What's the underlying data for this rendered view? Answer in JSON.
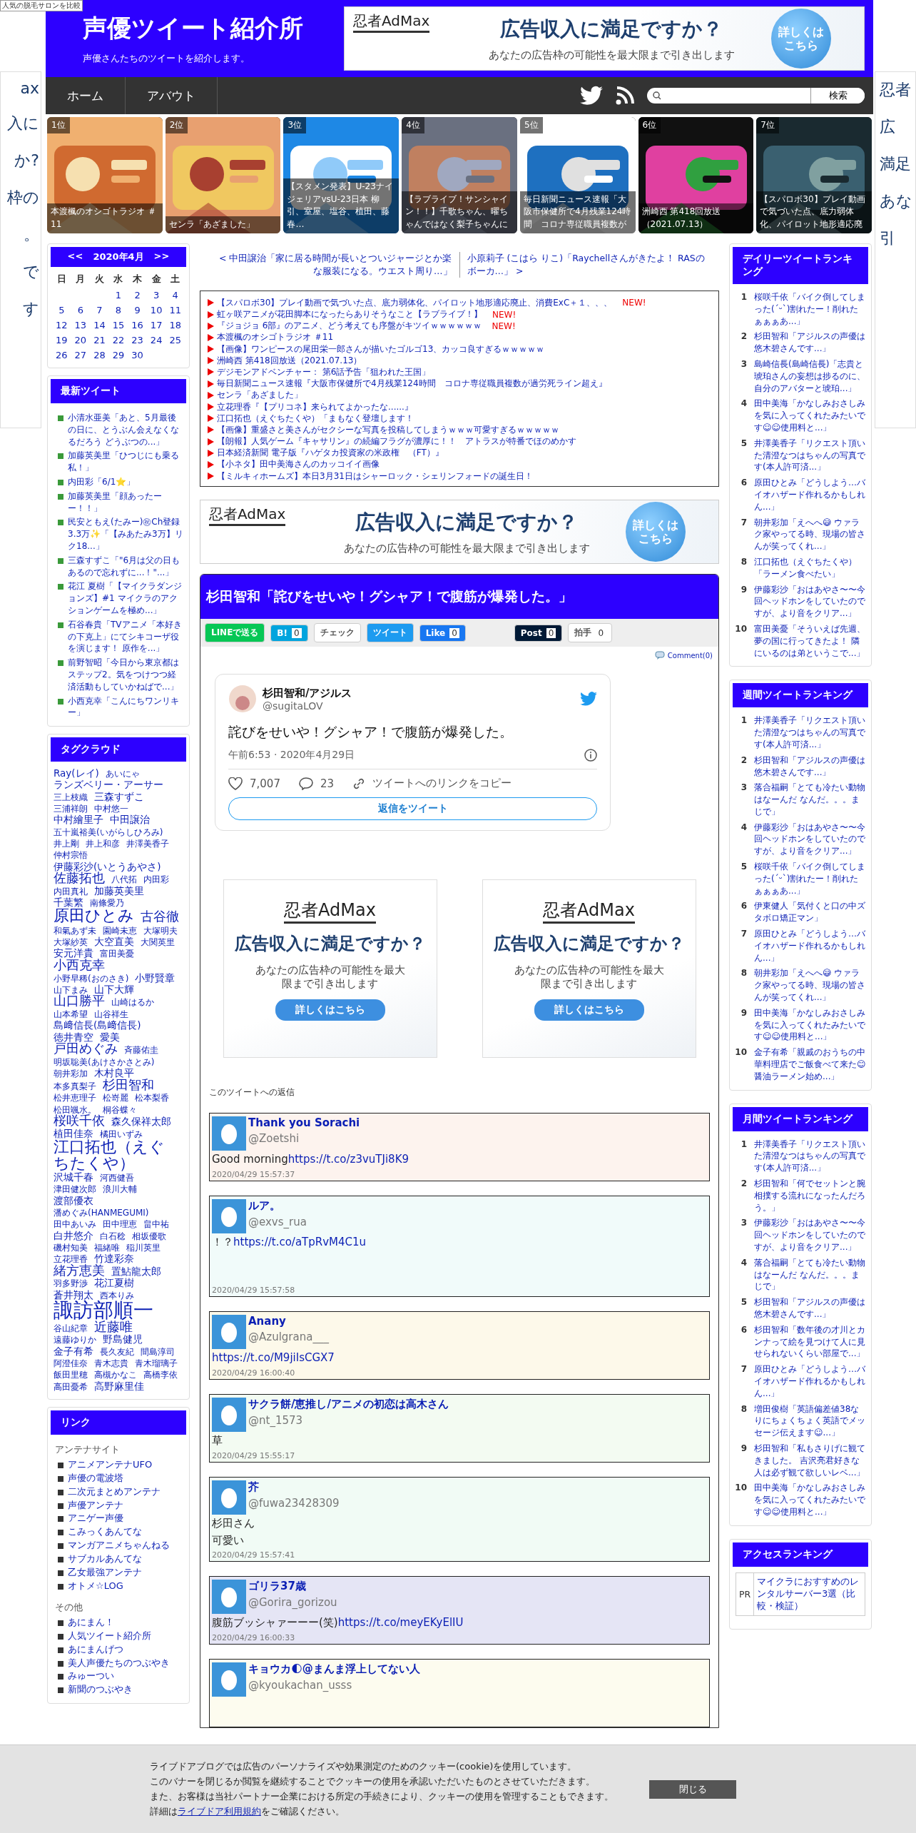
{
  "corner_label": "人気の脱毛サロンを比較",
  "side_ads": {
    "left": [
      "ax",
      "入に",
      "か?",
      "枠の",
      "。",
      "で",
      "す"
    ],
    "right": [
      "忍者",
      "広",
      "満足",
      "あな",
      "引"
    ]
  },
  "header": {
    "title": "声優ツイート紹介所",
    "subtitle": "声優さんたちのツイートを紹介します。",
    "ad": {
      "brand": "忍者AdMax",
      "headline": "広告収入に満足ですか？",
      "subline": "あなたの広告枠の可能性を最大限まで引き出します",
      "cta": "詳しくはこちら"
    }
  },
  "nav": {
    "items": [
      {
        "label": "ホーム"
      },
      {
        "label": "アバウト"
      }
    ],
    "search_button": "検索"
  },
  "featured": [
    {
      "rank": "1位",
      "caption": "本渡楓のオシゴトラジオ ＃11"
    },
    {
      "rank": "2位",
      "caption": "センラ「あざました」"
    },
    {
      "rank": "3位",
      "caption": "【スタメン発表】U-23ナイジェリアvsU-23日本 柳引、室屋、塩谷、植田、藤春…"
    },
    {
      "rank": "4位",
      "caption": "【ラブライブ！サンシャイン！！】千歌ちゃん、曜ちゃんではなく梨子ちゃんに"
    },
    {
      "rank": "5位",
      "caption": "毎日新聞ニュース速報「大阪市保健所で4月残業124時間　コロナ専従職員複数が"
    },
    {
      "rank": "6位",
      "caption": "洲崎西 第418回放送（2021.07.13）"
    },
    {
      "rank": "7位",
      "caption": "【スパロボ30】プレイ動画で気づいた点、底力弱体化、パイロット地形適応廃"
    }
  ],
  "calendar": {
    "prev": "<<",
    "month": "2020年4月",
    "next": ">>",
    "weekdays": [
      "日",
      "月",
      "火",
      "水",
      "木",
      "金",
      "土"
    ],
    "weeks": [
      [
        "1",
        "2",
        "3",
        "4"
      ],
      [
        "5",
        "6",
        "7",
        "8",
        "9",
        "10",
        "11"
      ],
      [
        "12",
        "13",
        "14",
        "15",
        "16",
        "17",
        "18"
      ],
      [
        "19",
        "20",
        "21",
        "22",
        "23",
        "24",
        "25"
      ],
      [
        "26",
        "27",
        "28",
        "29",
        "30"
      ]
    ]
  },
  "latest_tweets": {
    "title": "最新ツイート",
    "items": [
      "小清水亜美「あと、5月最後の日に、とうぶん会えなくなるだろう どうぶつの...」",
      "加藤英美里「ひつじにも乗る私！」",
      "内田彩「6/1⭐」",
      "加藤英美里「顔あったーー！！」",
      "民安ともえ(たみー)㊗Ch登録3.3万✨「【みあたみ3万】リク18...」",
      "三森すずこ「\"6月は父の日もあるので忘れずに...！\"...」",
      "花江 夏樹「【マイクラダンジョンズ】#1 マイクラのアクションゲームを極め...」",
      "石谷春貴「TVアニメ「本好きの下克上」にてシキコーザ役を演じます！ 原作を...」",
      "前野智昭「今日から東京都はステップ2。気をつけつつ経済活動もしていかねばで...」",
      "小西克幸「こんにちワンリキー」"
    ]
  },
  "tag_cloud": {
    "title": "タグクラウド",
    "tags": [
      {
        "label": "Ray(レイ)",
        "kind": "medium"
      },
      {
        "label": "あいにゃ",
        "kind": "small"
      },
      {
        "label": "ランズベリー・アーサー",
        "kind": "medium"
      },
      {
        "label": "三上枝織",
        "kind": "small"
      },
      {
        "label": "三森すずこ",
        "kind": "medium"
      },
      {
        "label": "三浦祥朗",
        "kind": "small"
      },
      {
        "label": "中村悠一",
        "kind": "small"
      },
      {
        "label": "中村繪里子",
        "kind": "medium"
      },
      {
        "label": "中田譲治",
        "kind": "medium"
      },
      {
        "label": "五十嵐裕美(いがらしひろみ)",
        "kind": "small"
      },
      {
        "label": "井上剛",
        "kind": "small"
      },
      {
        "label": "井上和彦",
        "kind": "small"
      },
      {
        "label": "井澤美香子",
        "kind": "small"
      },
      {
        "label": "仲村宗悟",
        "kind": "small"
      },
      {
        "label": "伊藤彩沙(いとうあやさ)",
        "kind": "medium"
      },
      {
        "label": "佐藤拓也",
        "kind": "large"
      },
      {
        "label": "八代拓",
        "kind": "small"
      },
      {
        "label": "内田彩",
        "kind": "small"
      },
      {
        "label": "内田真礼",
        "kind": "small"
      },
      {
        "label": "加藤英美里",
        "kind": "medium"
      },
      {
        "label": "千葉繁",
        "kind": "medium"
      },
      {
        "label": "南條愛乃",
        "kind": "small"
      },
      {
        "label": "原田ひとみ",
        "kind": "huge"
      },
      {
        "label": "古谷徹",
        "kind": "large"
      },
      {
        "label": "和氣あず未",
        "kind": "small"
      },
      {
        "label": "園崎未恵",
        "kind": "small"
      },
      {
        "label": "大塚明夫",
        "kind": "small"
      },
      {
        "label": "大塚紗英",
        "kind": "small"
      },
      {
        "label": "大空直美",
        "kind": "medium"
      },
      {
        "label": "大関英里",
        "kind": "small"
      },
      {
        "label": "安元洋貴",
        "kind": "medium"
      },
      {
        "label": "富田美憂",
        "kind": "small"
      },
      {
        "label": "小西克幸",
        "kind": "large"
      },
      {
        "label": "小野早稀(おのさき)",
        "kind": "small"
      },
      {
        "label": "小野賢章",
        "kind": "medium"
      },
      {
        "label": "山下まみ",
        "kind": "small"
      },
      {
        "label": "山下大輝",
        "kind": "medium"
      },
      {
        "label": "山口勝平",
        "kind": "large"
      },
      {
        "label": "山崎はるか",
        "kind": "small"
      },
      {
        "label": "山本希望",
        "kind": "small"
      },
      {
        "label": "山谷祥生",
        "kind": "small"
      },
      {
        "label": "島﨑信長(島﨑信長)",
        "kind": "medium"
      },
      {
        "label": "徳井青空",
        "kind": "medium"
      },
      {
        "label": "愛美",
        "kind": "medium"
      },
      {
        "label": "戸田めぐみ",
        "kind": "large"
      },
      {
        "label": "斉藤佑圭",
        "kind": "small"
      },
      {
        "label": "明坂聡美(あけさかさとみ)",
        "kind": "small"
      },
      {
        "label": "朝井彩加",
        "kind": "small"
      },
      {
        "label": "木村良平",
        "kind": "medium"
      },
      {
        "label": "本多真梨子",
        "kind": "small"
      },
      {
        "label": "杉田智和",
        "kind": "large"
      },
      {
        "label": "松井恵理子",
        "kind": "small"
      },
      {
        "label": "松嵜麗",
        "kind": "small"
      },
      {
        "label": "松本梨香",
        "kind": "small"
      },
      {
        "label": "松田颯水。",
        "kind": "small"
      },
      {
        "label": "桐谷蝶々",
        "kind": "small"
      },
      {
        "label": "桜咲千依",
        "kind": "large"
      },
      {
        "label": "森久保祥太郎",
        "kind": "medium"
      },
      {
        "label": "植田佳奈",
        "kind": "medium"
      },
      {
        "label": "橘田いずみ",
        "kind": "small"
      },
      {
        "label": "江口拓也（えぐちたくや）",
        "kind": "huge"
      },
      {
        "label": "沢城千春",
        "kind": "medium"
      },
      {
        "label": "河西健吾",
        "kind": "small"
      },
      {
        "label": "津田健次郎",
        "kind": "small"
      },
      {
        "label": "浪川大輔",
        "kind": "small"
      },
      {
        "label": "渡部優衣",
        "kind": "medium"
      },
      {
        "label": "潘めぐみ(HANMEGUMI)",
        "kind": "small"
      },
      {
        "label": "田中あいみ",
        "kind": "small"
      },
      {
        "label": "田中理恵",
        "kind": "small"
      },
      {
        "label": "畠中祐",
        "kind": "small"
      },
      {
        "label": "白井悠介",
        "kind": "medium"
      },
      {
        "label": "白石稔",
        "kind": "small"
      },
      {
        "label": "相坂優歌",
        "kind": "small"
      },
      {
        "label": "磯村知美",
        "kind": "small"
      },
      {
        "label": "福緒唯",
        "kind": "small"
      },
      {
        "label": "稲川英里",
        "kind": "small"
      },
      {
        "label": "立花理香",
        "kind": "small"
      },
      {
        "label": "竹達彩奈",
        "kind": "medium"
      },
      {
        "label": "緒方恵美",
        "kind": "large"
      },
      {
        "label": "置鮎龍太郎",
        "kind": "medium"
      },
      {
        "label": "羽多野渉",
        "kind": "small"
      },
      {
        "label": "花江夏樹",
        "kind": "medium"
      },
      {
        "label": "蒼井翔太",
        "kind": "medium"
      },
      {
        "label": "西本りみ",
        "kind": "small"
      },
      {
        "label": "諏訪部順一",
        "kind": "giant"
      },
      {
        "label": "谷山紀章",
        "kind": "small"
      },
      {
        "label": "近藤唯",
        "kind": "large"
      },
      {
        "label": "遠藤ゆりか",
        "kind": "small"
      },
      {
        "label": "野島健児",
        "kind": "medium"
      },
      {
        "label": "金子有希",
        "kind": "medium"
      },
      {
        "label": "長久友紀",
        "kind": "small"
      },
      {
        "label": "間島淳司",
        "kind": "small"
      },
      {
        "label": "阿澄佳奈",
        "kind": "small"
      },
      {
        "label": "青木志貴",
        "kind": "small"
      },
      {
        "label": "青木瑠璃子",
        "kind": "small"
      },
      {
        "label": "飯田里穂",
        "kind": "small"
      },
      {
        "label": "高槻かなこ",
        "kind": "small"
      },
      {
        "label": "高橋李依",
        "kind": "small"
      },
      {
        "label": "高田憂希",
        "kind": "small"
      },
      {
        "label": "高野麻里佳",
        "kind": "medium"
      }
    ]
  },
  "links": {
    "title": "リンク",
    "groups": [
      {
        "heading": "アンテナサイト",
        "items": [
          "アニメアンテナUFO",
          "声優の電波塔",
          "二次元まとめアンテナ",
          "声優アンテナ",
          "アニゲー声優",
          "こみっくあんてな",
          "マンガアニメちゃんねる",
          "サブカルあんてな",
          "乙女最強アンテナ",
          "オトメ☆LOG"
        ]
      },
      {
        "heading": "その他",
        "items": [
          "あにまん！",
          "人気ツイート紹介所",
          "あにまんげつ",
          "美人声優たちのつぶやき",
          "みゅーつい",
          "新聞のつぶやき"
        ]
      }
    ]
  },
  "article_nav": {
    "prev": "< 中田譲治「家に居る時間が長いとついジャージとか楽な服装になる。ウエスト周り…」",
    "next": "小原莉子 (こはら りこ)「Raychellさんがきたよ！ RASのボーカ…」 >"
  },
  "news": [
    {
      "text": "【スパロボ30】プレイ動画で気づいた点、底力弱体化、パイロット地形適応廃止、消費ExC＋１、、、",
      "badge": "NEW!"
    },
    {
      "text": "虹ヶ咲アニメが花田脚本になったらありそうなこと【ラブライブ！】",
      "badge": "NEW!"
    },
    {
      "text": "『ジョジョ 6部』のアニメ、どう考えても序盤がキツイｗｗｗｗｗｗ",
      "badge": "NEW!"
    },
    {
      "text": "本渡楓のオシゴトラジオ ＃11"
    },
    {
      "text": "【画像】ワンピースの尾田栄一郎さんが描いたゴルゴ13、カッコ良すぎるｗｗｗｗｗ"
    },
    {
      "text": "洲崎西 第418回放送（2021.07.13）"
    },
    {
      "text": "デジモンアドベンチャー： 第6話予告「狙われた王国」"
    },
    {
      "text": "毎日新聞ニュース速報『大阪市保健所で4月残業124時間　コロナ専従職員複数が過労死ライン超え』"
    },
    {
      "text": "センラ「あざました」"
    },
    {
      "text": "立花理香『【プリコネ】来られてよかったな......』"
    },
    {
      "text": "江口拓也（えぐちたくや）「まもなく登壇します！"
    },
    {
      "text": "【画像】重盛さと美さんがセクシーな写真を投稿してしまうｗｗｗ可愛すぎるｗｗｗｗｗ"
    },
    {
      "text": "【朗報】人気ゲーム『キャサリン』の続編フラグが濃厚に！！　アトラスが特番でほのめかす"
    },
    {
      "text": "日本経済新聞 電子版『ハゲタカ投資家の米政権　（FT）』"
    },
    {
      "text": "【小ネタ】田中美海さんのカッコイイ画像"
    },
    {
      "text": "【ミルキィホームズ】本日3月31日はシャーロック・シェリンフォードの誕生日！"
    }
  ],
  "article": {
    "title": "杉田智和「詫びをせいや！グシャア！で腹筋が爆発した。」",
    "share": [
      {
        "kind": "line",
        "label": "LINEで送る"
      },
      {
        "kind": "hatena",
        "label": "B!",
        "count": "0"
      },
      {
        "kind": "check",
        "label": "チェック"
      },
      {
        "kind": "tweet",
        "label": "ツイート"
      },
      {
        "kind": "like",
        "label": "Like",
        "count": "0"
      },
      {
        "kind": "post",
        "label": "Post",
        "count": "0"
      },
      {
        "kind": "clap",
        "label": "拍手",
        "count": "0"
      }
    ],
    "comments": "Comment(0)",
    "tweet": {
      "name": "杉田智和/アジルス",
      "handle": "@sugitaLOV",
      "text": "詫びをせいや！グシャア！で腹筋が爆発した。",
      "time": "午前6:53 · 2020年4月29日",
      "likes": "7,007",
      "replies": "23",
      "copy_link": "ツイートへのリンクをコピー",
      "reply_button": "返信をツイート"
    },
    "ad": {
      "brand": "忍者AdMax",
      "headline": "広告収入に満足ですか？",
      "subline": "あなたの広告枠の可能性を最大限まで引き出します",
      "cta": "詳しくはこちら"
    },
    "box_ads": [
      {
        "brand": "忍者AdMax",
        "headline": "広告収入に満足ですか？",
        "subline": "あなたの広告枠の可能性を最大限まで引き出します",
        "cta": "詳しくはこちら"
      },
      {
        "brand": "忍者AdMax",
        "headline": "広告収入に満足ですか？",
        "subline": "あなたの広告枠の可能性を最大限まで引き出します",
        "cta": "詳しくはこちら"
      }
    ],
    "replies_heading": "このツイートへの返信",
    "replies": [
      {
        "name": "Thank you Sorachi",
        "handle": "@Zoetshi",
        "text": "Good morning",
        "link": "https://t.co/z3vuTJi8K9",
        "time": "2020/04/29 15:57:37",
        "color": "#fdf3ee"
      },
      {
        "name": "ルア。",
        "handle": "@exvs_rua",
        "text": "！？",
        "link": "https://t.co/aTpRvM4C1u",
        "time": "2020/04/29 15:57:58",
        "color": "#f1fbfa",
        "tall": true
      },
      {
        "name": "Anany",
        "handle": "@Azulgrana___",
        "link": "https://t.co/M9jiIsCGX7",
        "time": "2020/04/29 16:00:40",
        "color": "#fdf9ea"
      },
      {
        "name": "サクラ餅/恵推し/アニメの初恋は高木さん",
        "handle": "@nt_1573",
        "text": "草",
        "time": "2020/04/29 15:55:17",
        "color": "#f3fbf2"
      },
      {
        "name": "芥",
        "handle": "@fuwa23428309",
        "lines": [
          "杉田さん",
          "可愛い"
        ],
        "time": "2020/04/29 15:57:41",
        "color": "#f1fbf5"
      },
      {
        "name": "ゴリラ37歳",
        "handle": "@Gorira_gorizou",
        "text": "腹筋ブッシャァーーー(笑)",
        "link": "https://t.co/meyEKyElIU",
        "time": "2020/04/29 16:00:33",
        "color": "#e5e5f5"
      },
      {
        "name": "キョウカ🌓@まんま浮上してない人",
        "handle": "@kyoukachan_usss",
        "color": "#fdfcef"
      }
    ]
  },
  "rankings": [
    {
      "title": "デイリーツイートランキング",
      "items": [
        {
          "rank": "1",
          "text": "桜咲千依「バイク倒してしまった(´ᵕ`)割れたー！削れたぁぁぁあ...」"
        },
        {
          "rank": "2",
          "text": "杉田智和「アジルスの声優は悠木碧さんです...」"
        },
        {
          "rank": "3",
          "text": "島崎信長(島崎信長)「志貴と琥珀さんの妄想は捗るのに、自分のアバターと琥珀...」"
        },
        {
          "rank": "4",
          "text": "田中美海「かなしみおさしみを気に入ってくれたみたいです☺☺使用料と...」"
        },
        {
          "rank": "5",
          "text": "井澤美香子「リクエスト頂いた清澄なつはちゃんの写真です(本人許可済...」"
        },
        {
          "rank": "6",
          "text": "原田ひとみ「どうしよう…バイオハザード作れるかもしれん...」"
        },
        {
          "rank": "7",
          "text": "朝井彩加「えへへ😅 ウァラク家やってる時、現場の皆さんが笑ってくれ...」"
        },
        {
          "rank": "8",
          "text": "江口拓也（えぐちたくや）「ラーメン食べたい」"
        },
        {
          "rank": "9",
          "text": "伊藤彩沙「おはあやさ〜〜今回ヘッドホンをしていたのですが、より音をクリア...」"
        },
        {
          "rank": "10",
          "text": "富田美憂「そういえば先週、夢の国に行ってきたよ！ 隣にいるのは弟というこで...」"
        }
      ]
    },
    {
      "title": "週間ツイートランキング",
      "items": [
        {
          "rank": "1",
          "text": "井澤美香子「リクエスト頂いた清澄なつはちゃんの写真です(本人許可済...」"
        },
        {
          "rank": "2",
          "text": "杉田智和「アジルスの声優は悠木碧さんです...」"
        },
        {
          "rank": "3",
          "text": "落合福嗣「とても冷たい動物はなーんだ なんだ。。。まじで」"
        },
        {
          "rank": "4",
          "text": "伊藤彩沙「おはあやさ〜〜今回ヘッドホンをしていたのですが、より音をクリア...」"
        },
        {
          "rank": "5",
          "text": "桜咲千依「バイク倒してしまった(´ᵕ`)割れたー！削れたぁぁぁあ...」"
        },
        {
          "rank": "6",
          "text": "伊東健人「気付くと口の中ズタボロ矯正マン」"
        },
        {
          "rank": "7",
          "text": "原田ひとみ「どうしよう…バイオハザード作れるかもしれん...」"
        },
        {
          "rank": "8",
          "text": "朝井彩加「えへへ😅 ウァラク家やってる時、現場の皆さんが笑ってくれ...」"
        },
        {
          "rank": "9",
          "text": "田中美海「かなしみおさしみを気に入ってくれたみたいです☺☺使用料と...」"
        },
        {
          "rank": "10",
          "text": "金子有希「親戚のおうちの中華料理店でご飯食べて来た😊 醤油ラーメン始め...」"
        }
      ]
    },
    {
      "title": "月間ツイートランキング",
      "items": [
        {
          "rank": "1",
          "text": "井澤美香子「リクエスト頂いた清澄なつはちゃんの写真です(本人許可済...」"
        },
        {
          "rank": "2",
          "text": "杉田智和「何でセットンと腕相撲する流れになったんだろう。」"
        },
        {
          "rank": "3",
          "text": "伊藤彩沙「おはあやさ〜〜今回ヘッドホンをしていたのですが、より音をクリア...」"
        },
        {
          "rank": "4",
          "text": "落合福嗣「とても冷たい動物はなーんだ なんだ。。。まじで」"
        },
        {
          "rank": "5",
          "text": "杉田智和「アジルスの声優は悠木碧さんです...」"
        },
        {
          "rank": "6",
          "text": "杉田智和「数年後の才川とカンナって絵を見つけて人に見せられないくらい部屋で...」"
        },
        {
          "rank": "7",
          "text": "原田ひとみ「どうしよう…バイオハザード作れるかもしれん...」"
        },
        {
          "rank": "8",
          "text": "増田俊樹「英語偏差値38なりにちょくちょく英語でメッセージ伝えます☺...」"
        },
        {
          "rank": "9",
          "text": "杉田智和「私もさりげに観てきました。 吉沢亮君好きな人は必ず観て欲しいレベ...」"
        },
        {
          "rank": "10",
          "text": "田中美海「かなしみおさしみを気に入ってくれたみたいです☺☺使用料と...」"
        }
      ]
    }
  ],
  "access_ranking": {
    "title": "アクセスランキング",
    "rows": [
      {
        "label": "PR",
        "text": "マイクラにおすすめのレンタルサーバー3選（比較・検証）"
      }
    ]
  },
  "cookie_banner": {
    "lines": [
      "ライブドアブログでは広告のパーソナライズや効果測定のためのクッキー(cookie)を使用しています。",
      "このバナーを閉じるか閲覧を継続することでクッキーの使用を承認いただいたものとさせていただきます。",
      "また、お客様は当社パートナー企業における所定の手続きにより、クッキーの使用を管理することもできます。"
    ],
    "detail_prefix": "詳細は",
    "detail_link": "ライブドア利用規約",
    "detail_suffix": "をご確認ください。",
    "close": "閉じる"
  }
}
